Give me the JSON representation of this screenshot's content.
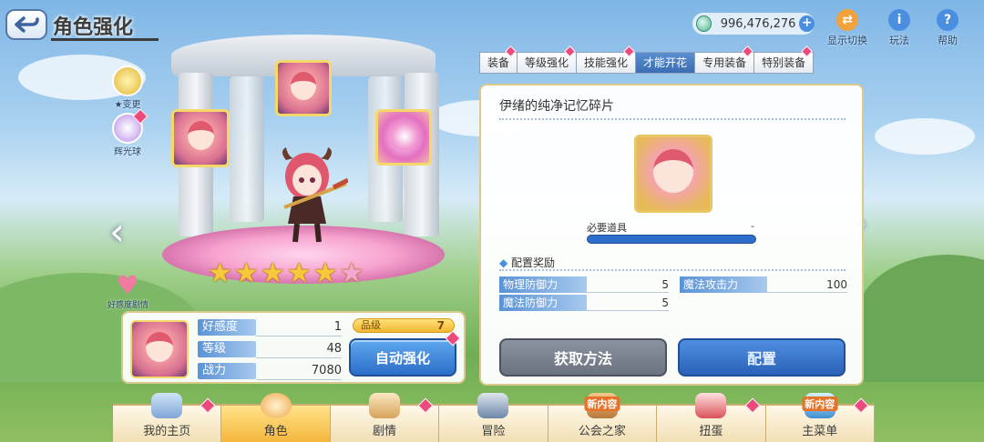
{
  "header": {
    "title": "角色强化",
    "currency_value": "996,476,276"
  },
  "top_icons": [
    {
      "label": "显示切换"
    },
    {
      "label": "玩法"
    },
    {
      "label": "帮助"
    }
  ],
  "left_side": {
    "change_label": "★变更",
    "orb_label": "辉光球",
    "affinity_label": "好感度剧情"
  },
  "stars": {
    "filled": 5,
    "total": 6
  },
  "info": {
    "stats": [
      {
        "label": "好感度",
        "value": "1"
      },
      {
        "label": "等级",
        "value": "48"
      },
      {
        "label": "战力",
        "value": "7080"
      }
    ],
    "rank_label": "品级",
    "rank_value": "7",
    "auto_button": "自动强化"
  },
  "tabs": [
    {
      "label": "装备",
      "active": false
    },
    {
      "label": "等级强化",
      "active": false
    },
    {
      "label": "技能强化",
      "active": false
    },
    {
      "label": "才能开花",
      "active": true
    },
    {
      "label": "专用装备",
      "active": false
    },
    {
      "label": "特别装备",
      "active": false
    }
  ],
  "panel": {
    "item_title": "伊绪的纯净记忆碎片",
    "required_label": "必要道具",
    "required_value": "-",
    "bonus_header": "配置奖励",
    "bonuses": [
      {
        "label": "物理防御力",
        "value": "5"
      },
      {
        "label": "魔法攻击力",
        "value": "100"
      },
      {
        "label": "魔法防御力",
        "value": "5"
      }
    ],
    "obtain_button": "获取方法",
    "equip_button": "配置"
  },
  "bottom_nav": [
    {
      "label": "我的主页",
      "badge": ""
    },
    {
      "label": "角色",
      "badge": ""
    },
    {
      "label": "剧情",
      "badge": ""
    },
    {
      "label": "冒险",
      "badge": ""
    },
    {
      "label": "公会之家",
      "badge": "新内容"
    },
    {
      "label": "扭蛋",
      "badge": ""
    },
    {
      "label": "主菜单",
      "badge": "新内容"
    }
  ]
}
